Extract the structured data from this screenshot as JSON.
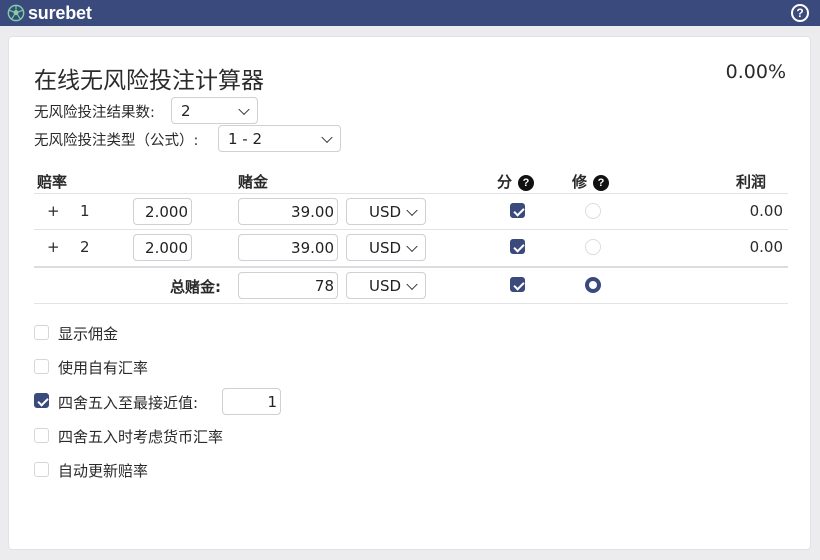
{
  "app": {
    "logo_text": "surebet",
    "help_icon": "?"
  },
  "calculator": {
    "title": "在线无风险投注计算器",
    "profit_percent": "0.00%",
    "outcomes": {
      "label": "无风险投注结果数:",
      "selected": "2"
    },
    "formula": {
      "label": "无风险投注类型（公式）:",
      "selected": "1 - 2"
    }
  },
  "table": {
    "headers": {
      "odds": "赔率",
      "stake": "赌金",
      "split": "分",
      "fix": "修",
      "profit": "利润"
    },
    "help_glyph": "?",
    "rows": [
      {
        "sign": "+",
        "index": "1",
        "odds": "2.000",
        "stake": "39.00",
        "currency": "USD",
        "split_checked": true,
        "fix_selected": false,
        "profit": "0.00"
      },
      {
        "sign": "+",
        "index": "2",
        "odds": "2.000",
        "stake": "39.00",
        "currency": "USD",
        "split_checked": true,
        "fix_selected": false,
        "profit": "0.00"
      }
    ],
    "total": {
      "label": "总赌金:",
      "stake": "78",
      "currency": "USD",
      "split_checked": true,
      "fix_selected": true
    }
  },
  "options": {
    "show_commission": {
      "label": "显示佣金",
      "checked": false
    },
    "own_rates": {
      "label": "使用自有汇率",
      "checked": false
    },
    "round": {
      "label": "四舍五入至最接近值:",
      "checked": true,
      "value": "1"
    },
    "round_currency": {
      "label": "四舍五入时考虑货币汇率",
      "checked": false
    },
    "auto_update": {
      "label": "自动更新赔率",
      "checked": false
    }
  },
  "colors": {
    "brand": "#3b4a7c",
    "accent_check": "#3b4a7c"
  }
}
